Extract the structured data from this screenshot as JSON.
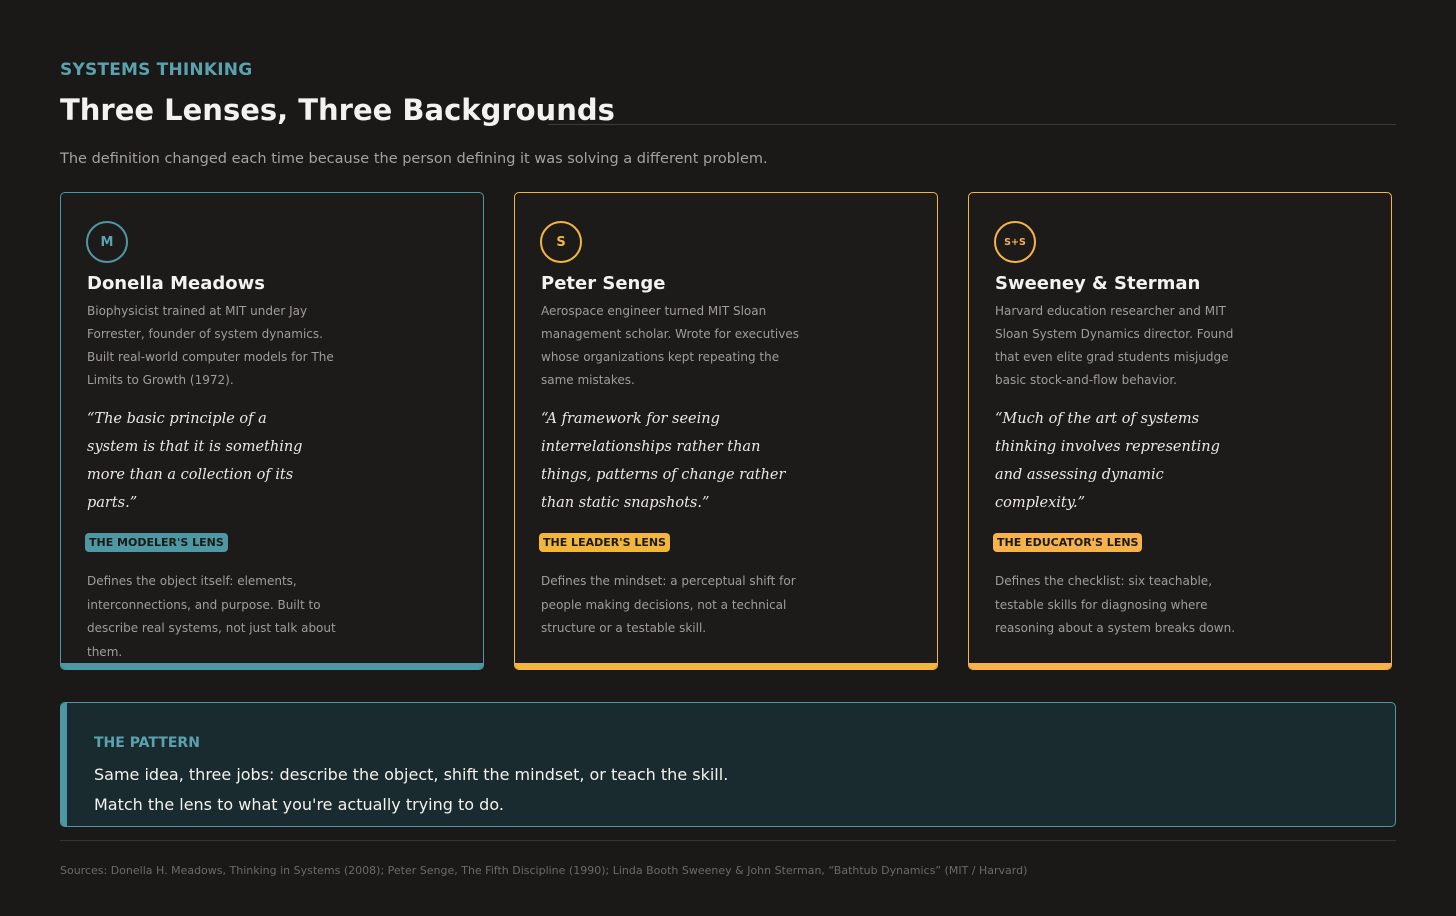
{
  "header": {
    "eyebrow": "SYSTEMS THINKING",
    "title": "Three Lenses, Three Backgrounds",
    "subtitle": "The definition changed each time because the person defining it was solving a different problem."
  },
  "colors": {
    "teal": "#4e98a3",
    "amber": "#f2b63c",
    "orange": "#f7b24a"
  },
  "cards": [
    {
      "initials": "M",
      "name": "Donella Meadows",
      "bio": "Biophysicist trained at MIT under Jay Forrester, founder of system dynamics. Built real-world computer models for The Limits to Growth (1972).",
      "quote": "“The basic principle of a system is that it is something more than a collection of its parts.”",
      "lens": "THE MODELER'S LENS",
      "description": "Defines the object itself: elements, interconnections, and purpose. Built to describe real systems, not just talk about them.",
      "color": "#4e98a3"
    },
    {
      "initials": "S",
      "name": "Peter Senge",
      "bio": "Aerospace engineer turned MIT Sloan management scholar. Wrote for executives whose organizations kept repeating the same mistakes.",
      "quote": "“A framework for seeing interrelationships rather than things, patterns of change rather than static snapshots.”",
      "lens": "THE LEADER'S LENS",
      "description": "Defines the mindset: a perceptual shift for people making decisions, not a technical structure or a testable skill.",
      "color": "#f2b63c"
    },
    {
      "initials": "S+S",
      "name": "Sweeney & Sterman",
      "bio": "Harvard education researcher and MIT Sloan System Dynamics director. Found that even elite grad students misjudge basic stock-and-flow behavior.",
      "quote": "“Much of the art of systems thinking involves representing and assessing dynamic complexity.”",
      "lens": "THE EDUCATOR'S LENS",
      "description": "Defines the checklist: six teachable, testable skills for diagnosing where reasoning about a system breaks down.",
      "color": "#f7b24a"
    }
  ],
  "pattern": {
    "label": "THE PATTERN",
    "line1": "Same idea, three jobs: describe the object, shift the mindset, or teach the skill.",
    "line2": "Match the lens to what you're actually trying to do."
  },
  "sources": "Sources: Donella H. Meadows, Thinking in Systems (2008); Peter Senge, The Fifth Discipline (1990); Linda Booth Sweeney & John Sterman, “Bathtub Dynamics” (MIT / Harvard)"
}
